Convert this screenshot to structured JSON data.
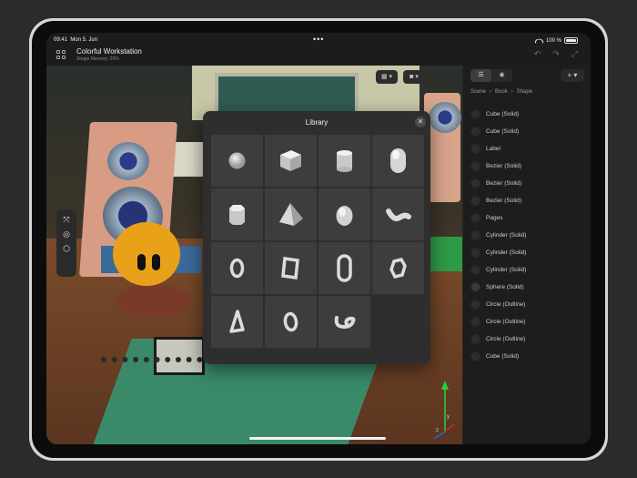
{
  "status": {
    "time": "09:41",
    "date": "Mon 5. Jun",
    "battery": "100 %"
  },
  "document": {
    "title": "Colorful Workstation",
    "subtitle": "Shape Memory: 29%"
  },
  "library": {
    "title": "Library",
    "close": "✕",
    "items": [
      {
        "name": "sphere-icon"
      },
      {
        "name": "cube-icon"
      },
      {
        "name": "cylinder-icon"
      },
      {
        "name": "capsule-icon"
      },
      {
        "name": "octagonal-prism-icon"
      },
      {
        "name": "pyramid-icon"
      },
      {
        "name": "egg-icon"
      },
      {
        "name": "bent-tube-icon"
      },
      {
        "name": "ring-icon"
      },
      {
        "name": "square-ring-icon"
      },
      {
        "name": "oval-ring-icon"
      },
      {
        "name": "hexagon-ring-icon"
      },
      {
        "name": "triangle-ring-icon"
      },
      {
        "name": "ellipse-ring-icon"
      },
      {
        "name": "knot-icon"
      }
    ]
  },
  "sidebar": {
    "breadcrumb": [
      "Scene",
      "Book",
      "Shape"
    ],
    "separator": "›",
    "add_label": "+",
    "layers": [
      "Cube (Solid)",
      "Cube (Solid)",
      "Label",
      "Bezier (Solid)",
      "Bezier (Solid)",
      "Bezier (Solid)",
      "Pages",
      "Cylinder (Solid)",
      "Cylinder (Solid)",
      "Cylinder (Solid)",
      "Sphere (Solid)",
      "Circle (Outline)",
      "Circle (Outline)",
      "Circle (Outline)",
      "Cube (Solid)"
    ]
  },
  "viewport": {
    "axes": {
      "y": "y",
      "z": "z"
    }
  }
}
